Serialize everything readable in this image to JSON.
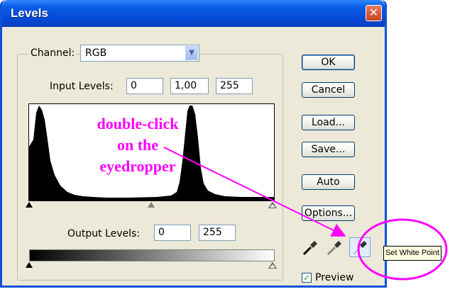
{
  "window": {
    "title": "Levels",
    "close_glyph": "✕"
  },
  "channel": {
    "label": "Channel:",
    "value": "RGB"
  },
  "input_levels": {
    "label": "Input Levels:",
    "black": "0",
    "gamma": "1,00",
    "white": "255"
  },
  "output_levels": {
    "label": "Output Levels:",
    "black": "0",
    "white": "255"
  },
  "buttons": {
    "ok": "OK",
    "cancel": "Cancel",
    "load": "Load...",
    "save": "Save...",
    "auto": "Auto",
    "options": "Options..."
  },
  "preview": {
    "label": "Preview",
    "checked": true
  },
  "tooltip": "Set White Point",
  "annotation": {
    "line1": "double-click",
    "line2": "on the",
    "line3": "eyedropper",
    "color": "#ff00ff"
  },
  "eyedroppers": [
    "black-point-eyedropper-icon",
    "gray-point-eyedropper-icon",
    "white-point-eyedropper-icon"
  ],
  "colors": {
    "titlebar": "#0a5ee6",
    "dialog_bg": "#ece9d8",
    "accent": "#ff00ff"
  }
}
